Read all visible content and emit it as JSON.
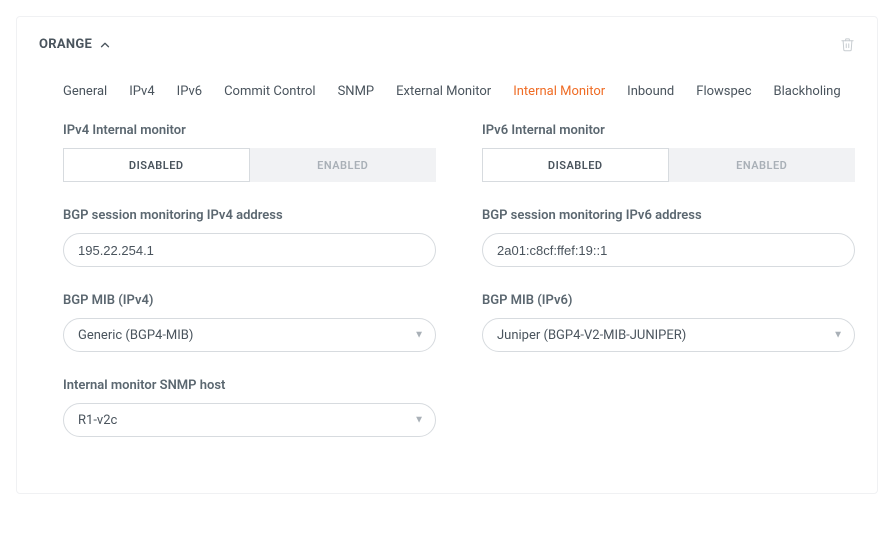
{
  "header": {
    "title": "ORANGE"
  },
  "tabs": [
    {
      "label": "General",
      "active": false
    },
    {
      "label": "IPv4",
      "active": false
    },
    {
      "label": "IPv6",
      "active": false
    },
    {
      "label": "Commit Control",
      "active": false
    },
    {
      "label": "SNMP",
      "active": false
    },
    {
      "label": "External Monitor",
      "active": false
    },
    {
      "label": "Internal Monitor",
      "active": true
    },
    {
      "label": "Inbound",
      "active": false
    },
    {
      "label": "Flowspec",
      "active": false
    },
    {
      "label": "Blackholing",
      "active": false
    }
  ],
  "monitor": {
    "ipv4": {
      "label": "IPv4 Internal monitor",
      "disabled_label": "DISABLED",
      "enabled_label": "ENABLED",
      "state": "disabled"
    },
    "ipv6": {
      "label": "IPv6 Internal monitor",
      "disabled_label": "DISABLED",
      "enabled_label": "ENABLED",
      "state": "disabled"
    }
  },
  "bgp": {
    "ipv4_label": "BGP session monitoring IPv4 address",
    "ipv4_value": "195.22.254.1",
    "ipv6_label": "BGP session monitoring IPv6 address",
    "ipv6_value": "2a01:c8cf:ffef:19::1"
  },
  "mib": {
    "ipv4_label": "BGP MIB (IPv4)",
    "ipv4_value": "Generic (BGP4-MIB)",
    "ipv6_label": "BGP MIB (IPv6)",
    "ipv6_value": "Juniper (BGP4-V2-MIB-JUNIPER)"
  },
  "snmp": {
    "label": "Internal monitor SNMP host",
    "value": "R1-v2c"
  }
}
